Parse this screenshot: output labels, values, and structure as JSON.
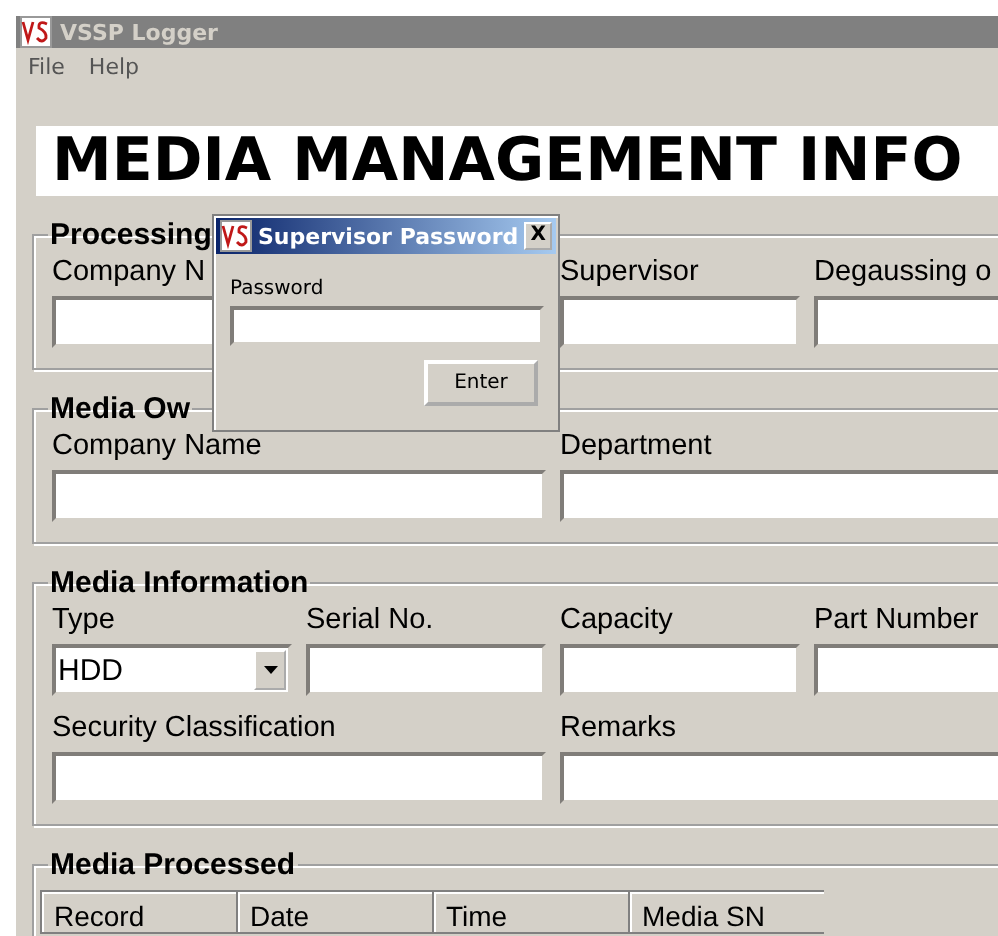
{
  "window": {
    "title": "VSSP Logger"
  },
  "menu": [
    "File",
    "Help"
  ],
  "banner": {
    "title": "MEDIA MANAGEMENT INFO"
  },
  "groups": [
    {
      "title": "Processing",
      "fields": [
        {
          "label": "Company N",
          "kind": "wide"
        },
        {
          "label": "Supervisor",
          "kind": "text"
        },
        {
          "label": "Degaussing o",
          "kind": "text"
        }
      ]
    },
    {
      "title": "Media Ow",
      "fields": [
        {
          "label": "Company Name",
          "kind": "wide"
        },
        {
          "label": "Department",
          "kind": "wide"
        }
      ]
    },
    {
      "title": "Media Information",
      "fields": [
        {
          "label": "Type",
          "kind": "combo",
          "value": "HDD"
        },
        {
          "label": "Serial No.",
          "kind": "text"
        },
        {
          "label": "Capacity",
          "kind": "text"
        },
        {
          "label": "Part Number",
          "kind": "text"
        },
        {
          "label": "Security Classification",
          "kind": "wide"
        },
        {
          "label": "Remarks",
          "kind": "wide"
        }
      ]
    }
  ],
  "media_processed": {
    "title": "Media Processed",
    "columns": [
      "Record",
      "Date",
      "Time",
      "Media SN"
    ]
  },
  "dialog": {
    "title": "Supervisor Password",
    "close": "X",
    "field_label": "Password",
    "button": "Enter"
  }
}
